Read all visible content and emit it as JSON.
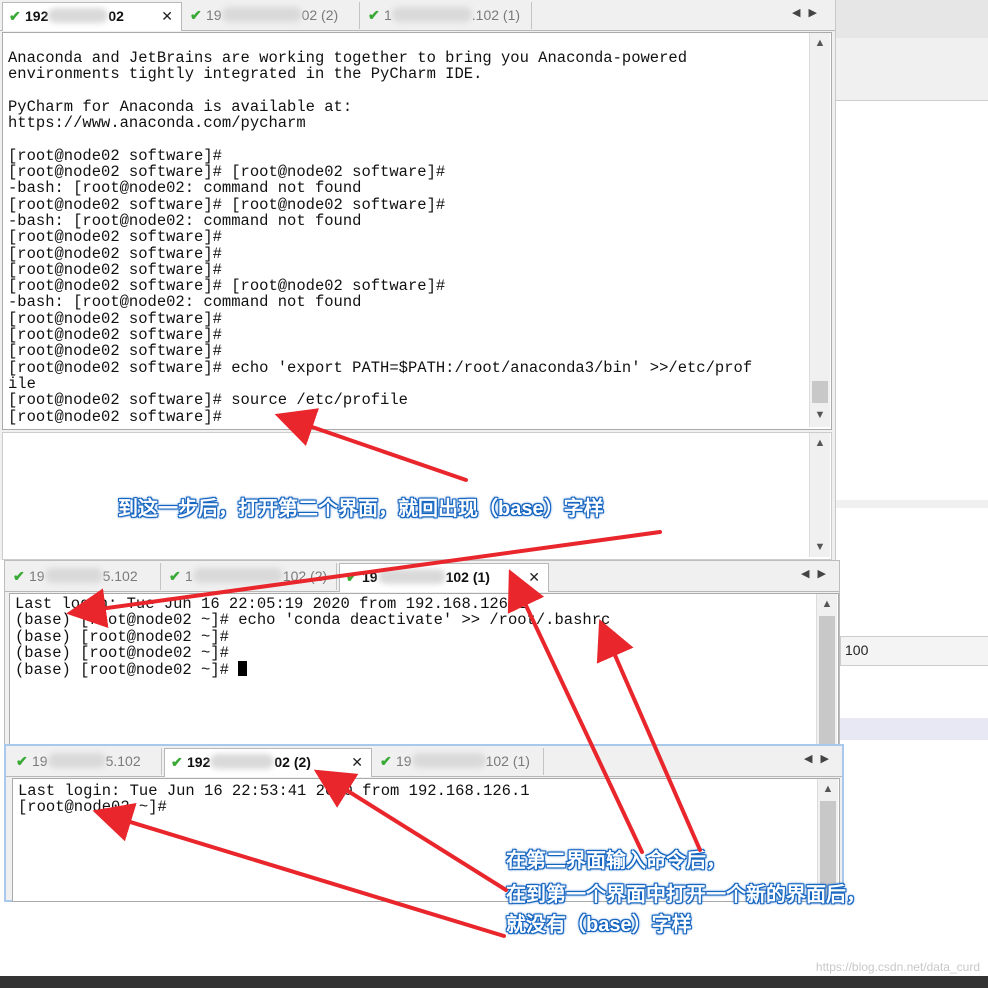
{
  "colors": {
    "accent_arrow": "#e8262c",
    "note_text": "#ffffff",
    "note_outline": "#1565c0",
    "check": "#39a935"
  },
  "bg_panel": {
    "label": "100"
  },
  "window1": {
    "tabs": [
      {
        "label": "192.168.126.102",
        "active": true
      },
      {
        "label": "192.168.126.102 (2)"
      },
      {
        "label": "192.168.126.102 (1)"
      }
    ],
    "lines": [
      "Anaconda and JetBrains are working together to bring you Anaconda-powered",
      "environments tightly integrated in the PyCharm IDE.",
      "",
      "PyCharm for Anaconda is available at:",
      "https://www.anaconda.com/pycharm",
      "",
      "[root@node02 software]#",
      "[root@node02 software]# [root@node02 software]#",
      "-bash: [root@node02: command not found",
      "[root@node02 software]# [root@node02 software]#",
      "-bash: [root@node02: command not found",
      "[root@node02 software]#",
      "[root@node02 software]#",
      "[root@node02 software]#",
      "[root@node02 software]# [root@node02 software]#",
      "-bash: [root@node02: command not found",
      "[root@node02 software]#",
      "[root@node02 software]#",
      "[root@node02 software]#",
      "[root@node02 software]# echo 'export PATH=$PATH:/root/anaconda3/bin' >>/etc/prof",
      "ile",
      "[root@node02 software]# source /etc/profile",
      "[root@node02 software]#"
    ]
  },
  "window2": {
    "tabs": [
      {
        "label": "192.168.126.102"
      },
      {
        "label": "192.168.126.102 (2)"
      },
      {
        "label": "192.168.126.102 (1)",
        "active": true
      }
    ],
    "lines": [
      "Last login: Tue Jun 16 22:05:19 2020 from 192.168.126.1",
      "(base) [root@node02 ~]# echo 'conda deactivate' >> /root/.bashrc",
      "(base) [root@node02 ~]#",
      "(base) [root@node02 ~]#",
      "(base) [root@node02 ~]# "
    ]
  },
  "window3": {
    "tabs": [
      {
        "label": "192.168.126.102"
      },
      {
        "label": "192.168.126.102 (2)",
        "active": true
      },
      {
        "label": "192.168.126.102 (1)"
      }
    ],
    "lines": [
      "Last login: Tue Jun 16 22:53:41 2020 from 192.168.126.1",
      "[root@node02 ~]#"
    ]
  },
  "annotations": {
    "note1": "到这一步后，打开第二个界面，就回出现（base）字样",
    "note2": "在第二界面输入命令后，",
    "note3": "在到第一个界面中打开一个新的界面后，",
    "note4": "就没有（base）字样"
  },
  "watermark": "https://blog.csdn.net/data_curd"
}
